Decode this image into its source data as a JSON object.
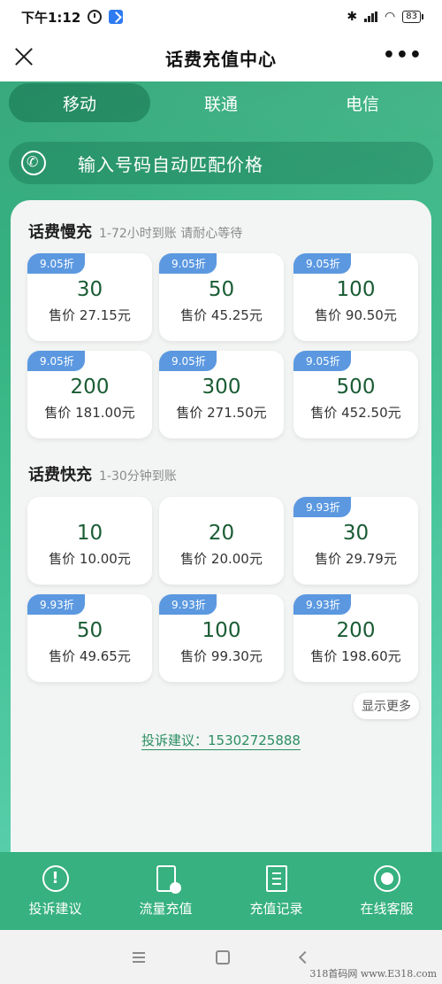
{
  "status_bar": {
    "time": "下午1:12",
    "battery": "83"
  },
  "title_bar": {
    "title": "话费充值中心",
    "more": "•••"
  },
  "tabs": [
    {
      "label": "移动",
      "active": true
    },
    {
      "label": "联通",
      "active": false
    },
    {
      "label": "电信",
      "active": false
    }
  ],
  "phone_input": {
    "placeholder": "输入号码自动匹配价格"
  },
  "slow_section": {
    "title": "话费慢充",
    "note": "1-72小时到账 请耐心等待",
    "cards": [
      {
        "badge": "9.05折",
        "amount": "30",
        "price": "售价 27.15元"
      },
      {
        "badge": "9.05折",
        "amount": "50",
        "price": "售价 45.25元"
      },
      {
        "badge": "9.05折",
        "amount": "100",
        "price": "售价 90.50元"
      },
      {
        "badge": "9.05折",
        "amount": "200",
        "price": "售价 181.00元"
      },
      {
        "badge": "9.05折",
        "amount": "300",
        "price": "售价 271.50元"
      },
      {
        "badge": "9.05折",
        "amount": "500",
        "price": "售价 452.50元"
      }
    ]
  },
  "fast_section": {
    "title": "话费快充",
    "note": "1-30分钟到账",
    "cards": [
      {
        "badge": "",
        "amount": "10",
        "price": "售价 10.00元"
      },
      {
        "badge": "",
        "amount": "20",
        "price": "售价 20.00元"
      },
      {
        "badge": "9.93折",
        "amount": "30",
        "price": "售价 29.79元"
      },
      {
        "badge": "9.93折",
        "amount": "50",
        "price": "售价 49.65元"
      },
      {
        "badge": "9.93折",
        "amount": "100",
        "price": "售价 99.30元"
      },
      {
        "badge": "9.93折",
        "amount": "200",
        "price": "售价 198.60元"
      }
    ]
  },
  "more_button": "显示更多",
  "complaint_line": "投诉建议：15302725888",
  "bottom_nav": [
    {
      "label": "投诉建议",
      "icon": "complaint-icon"
    },
    {
      "label": "流量充值",
      "icon": "mobile-data-icon"
    },
    {
      "label": "充值记录",
      "icon": "record-icon"
    },
    {
      "label": "在线客服",
      "icon": "customer-service-icon"
    }
  ],
  "watermark": "318首码网 www.E318.com"
}
